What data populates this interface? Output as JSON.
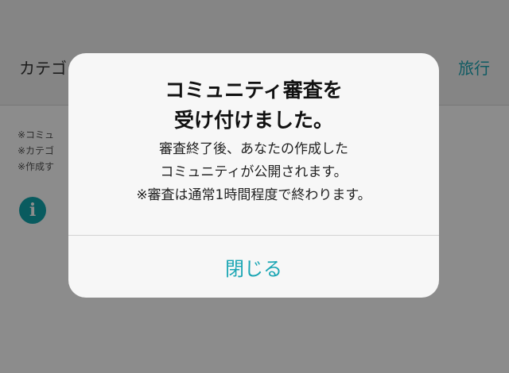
{
  "header": {
    "label": "カテゴ",
    "value": "旅行"
  },
  "notes": [
    "※コミュ",
    "※カテゴ",
    "※作成す"
  ],
  "dialog": {
    "title_line1": "コミュニティ審査を",
    "title_line2": "受け付けました。",
    "message_line1": "審査終了後、あなたの作成した",
    "message_line2": "コミュニティが公開されます。",
    "message_line3": "※審査は通常1時間程度で終わります。",
    "close_button": "閉じる"
  },
  "colors": {
    "accent": "#1ba6b4",
    "info_icon": "#12a6ae"
  },
  "icons": {
    "info": "info-icon"
  }
}
